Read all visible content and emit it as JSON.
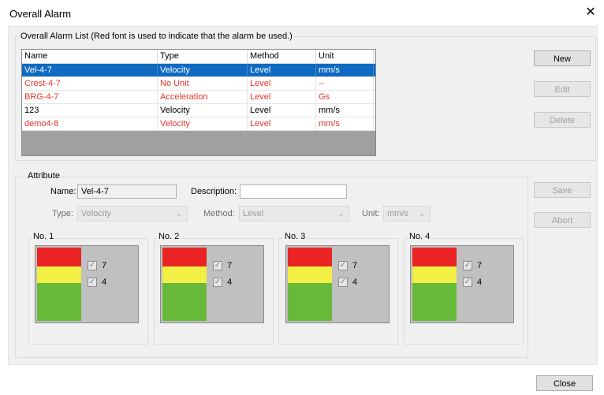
{
  "window": {
    "title": "Overall Alarm",
    "close_glyph": "✕"
  },
  "list_group": {
    "legend": "Overall Alarm List (Red font is used to indicate that the alarm be used.)",
    "columns": [
      "Name",
      "Type",
      "Method",
      "Unit"
    ],
    "rows": [
      {
        "name": "Vel-4-7",
        "type": "Velocity",
        "method": "Level",
        "unit": "mm/s",
        "used": true,
        "selected": true
      },
      {
        "name": "Crest-4-7",
        "type": "No Unit",
        "method": "Level",
        "unit": "--",
        "used": true,
        "selected": false
      },
      {
        "name": "BRG-4-7",
        "type": "Acceleration",
        "method": "Level",
        "unit": "Gs",
        "used": true,
        "selected": false
      },
      {
        "name": "123",
        "type": "Velocity",
        "method": "Level",
        "unit": "mm/s",
        "used": false,
        "selected": false
      },
      {
        "name": "demo4-8",
        "type": "Velocity",
        "method": "Level",
        "unit": "mm/s",
        "used": true,
        "selected": false
      }
    ]
  },
  "buttons": {
    "new": "New",
    "edit": "Edit",
    "delete": "Delete",
    "save": "Save",
    "abort": "Abort",
    "close": "Close"
  },
  "attribute": {
    "legend": "Attribute",
    "name_label": "Name:",
    "name_value": "Vel-4-7",
    "description_label": "Description:",
    "description_value": "",
    "type_label": "Type:",
    "type_value": "Velocity",
    "method_label": "Method:",
    "method_value": "Level",
    "unit_label": "Unit:",
    "unit_value": "mm/s",
    "levels": [
      {
        "label": "No. 1",
        "high": "7",
        "low": "4",
        "high_checked": true,
        "low_checked": true
      },
      {
        "label": "No. 2",
        "high": "7",
        "low": "4",
        "high_checked": true,
        "low_checked": true
      },
      {
        "label": "No. 3",
        "high": "7",
        "low": "4",
        "high_checked": true,
        "low_checked": true
      },
      {
        "label": "No. 4",
        "high": "7",
        "low": "4",
        "high_checked": true,
        "low_checked": true
      }
    ]
  },
  "colors": {
    "alarm_red": "#ea2424",
    "warning_yellow": "#f2ef45",
    "normal_green": "#67b93a",
    "used_font": "#e5352a",
    "selection": "#0f6ac1"
  }
}
